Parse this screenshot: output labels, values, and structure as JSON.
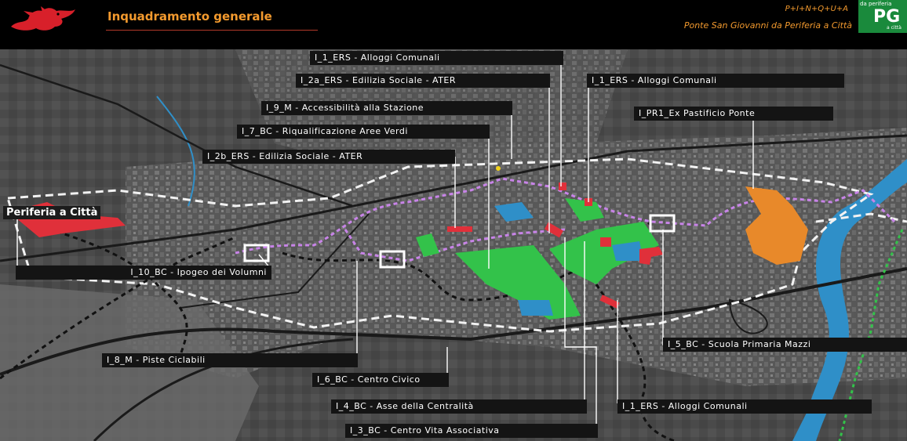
{
  "header": {
    "title": "Inquadramento generale",
    "code": "P+I+N+Q+U+A",
    "subtitle": "Ponte San Giovanni da Periferia a Città",
    "badge_top": "da periferia",
    "badge_main": "PG",
    "badge_bottom": "a città",
    "logo_icon": "red-griffin-icon"
  },
  "map": {
    "area_title": "Periferia a Città",
    "labels": [
      {
        "key": "l1",
        "text": "I_1_ERS - Alloggi Comunali"
      },
      {
        "key": "l2",
        "text": "I_2a_ERS - Edilizia Sociale - ATER"
      },
      {
        "key": "l3",
        "text": "I_1_ERS - Alloggi Comunali"
      },
      {
        "key": "l4",
        "text": "I_9_M - Accessibilità alla Stazione"
      },
      {
        "key": "l5",
        "text": "I_PR1_Ex Pastificio Ponte"
      },
      {
        "key": "l6",
        "text": "I_7_BC - Riqualificazione Aree Verdi"
      },
      {
        "key": "l7",
        "text": "I_2b_ERS - Edilizia Sociale - ATER"
      },
      {
        "key": "l8",
        "text": "I_10_BC - Ipogeo dei Volumni"
      },
      {
        "key": "l9",
        "text": "I_5_BC - Scuola Primaria Mazzi"
      },
      {
        "key": "l10",
        "text": "I_8_M - Piste Ciclabili"
      },
      {
        "key": "l11",
        "text": "I_6_BC - Centro Civico"
      },
      {
        "key": "l12",
        "text": "I_4_BC - Asse della Centralità"
      },
      {
        "key": "l13",
        "text": "I_1_ERS - Alloggi Comunali"
      },
      {
        "key": "l14",
        "text": "I_3_BC - Centro Vita Associativa"
      }
    ]
  },
  "colors": {
    "accent_orange": "#f39a2e",
    "green_areas": "#33c24a",
    "orange_area": "#e8892a",
    "red_areas": "#e0303a",
    "purple_route": "#c884e8",
    "river": "#2f8fc8",
    "badge_green": "#1a8a3c"
  }
}
